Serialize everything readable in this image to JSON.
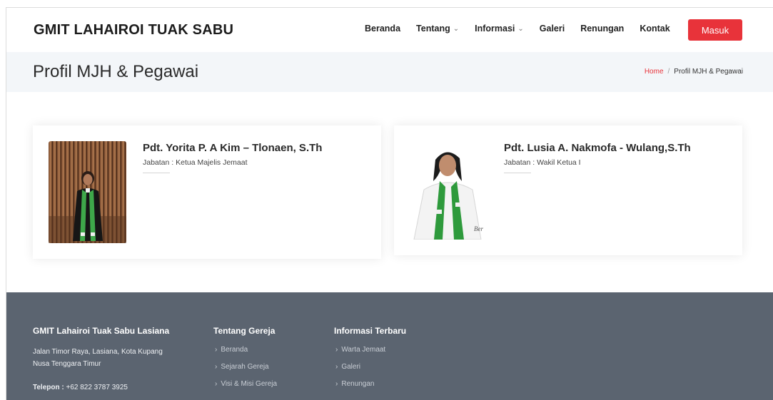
{
  "header": {
    "logo": "GMIT LAHAIROI TUAK SABU",
    "nav": [
      {
        "label": "Beranda",
        "dropdown": false
      },
      {
        "label": "Tentang",
        "dropdown": true
      },
      {
        "label": "Informasi",
        "dropdown": true
      },
      {
        "label": "Galeri",
        "dropdown": false
      },
      {
        "label": "Renungan",
        "dropdown": false
      },
      {
        "label": "Kontak",
        "dropdown": false
      }
    ],
    "login": "Masuk"
  },
  "titlebar": {
    "title": "Profil MJH & Pegawai",
    "breadcrumb_home": "Home",
    "breadcrumb_sep": "/",
    "breadcrumb_current": "Profil MJH & Pegawai"
  },
  "people": [
    {
      "name": "Pdt. Yorita P. A Kim – Tlonaen, S.Th",
      "role": "Jabatan : Ketua Majelis Jemaat"
    },
    {
      "name": "Pdt. Lusia A. Nakmofa - Wulang,S.Th",
      "role": "Jabatan : Wakil Ketua I"
    }
  ],
  "footer": {
    "col1": {
      "title": "GMIT Lahairoi Tuak Sabu Lasiana",
      "address_line1": "Jalan Timor Raya, Lasiana, Kota Kupang",
      "address_line2": "Nusa Tenggara Timur",
      "phone_label": "Telepon :",
      "phone_value": " +62 822 3787 3925"
    },
    "col2": {
      "title": "Tentang Gereja",
      "links": [
        "Beranda",
        "Sejarah Gereja",
        "Visi & Misi Gereja"
      ]
    },
    "col3": {
      "title": "Informasi Terbaru",
      "links": [
        "Warta Jemaat",
        "Galeri",
        "Renungan"
      ]
    }
  },
  "icons": {
    "chevron": "chevron-down-icon",
    "arrow": "chevron-right-icon"
  },
  "colors": {
    "accent": "#e8333a",
    "footer_bg": "#5b6470",
    "titlebar_bg": "#f3f6f9"
  }
}
